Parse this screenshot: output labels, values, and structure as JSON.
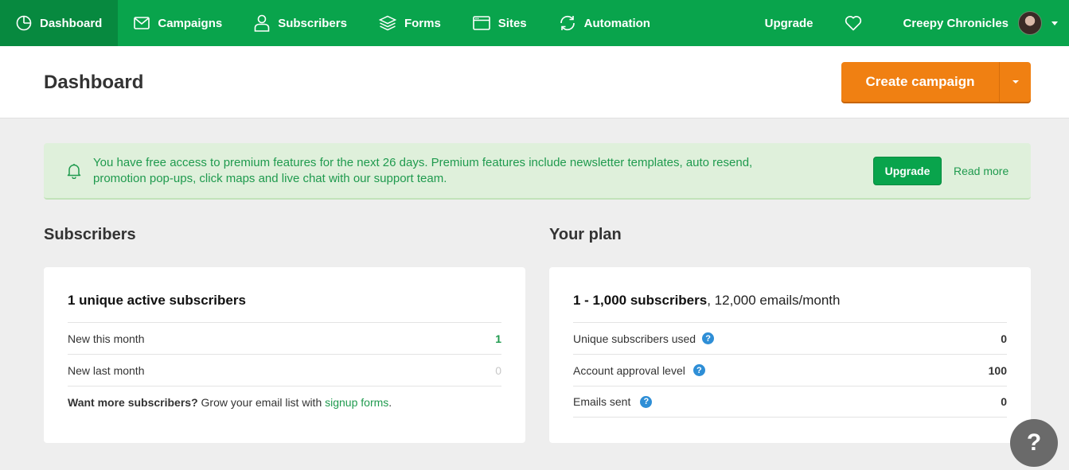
{
  "nav": {
    "items": [
      {
        "label": "Dashboard",
        "icon": "dashboard-icon"
      },
      {
        "label": "Campaigns",
        "icon": "mail-icon"
      },
      {
        "label": "Subscribers",
        "icon": "user-icon"
      },
      {
        "label": "Forms",
        "icon": "layers-icon"
      },
      {
        "label": "Sites",
        "icon": "browser-icon"
      },
      {
        "label": "Automation",
        "icon": "refresh-icon"
      }
    ],
    "upgrade_label": "Upgrade",
    "account_name": "Creepy Chronicles"
  },
  "header": {
    "title": "Dashboard",
    "create_label": "Create campaign"
  },
  "notice": {
    "text": "You have free access to premium features for the next 26 days. Premium features include newsletter templates, auto resend, promotion pop-ups, click maps and live chat with our support team.",
    "upgrade_label": "Upgrade",
    "read_more_label": "Read more"
  },
  "subscribers": {
    "section_title": "Subscribers",
    "headline": "1 unique active subscribers",
    "rows": [
      {
        "label": "New this month",
        "value": "1"
      },
      {
        "label": "New last month",
        "value": "0"
      }
    ],
    "cta_bold": "Want more subscribers?",
    "cta_text": " Grow your email list with ",
    "cta_link": "signup forms",
    "cta_end": "."
  },
  "plan": {
    "section_title": "Your plan",
    "headline_bold": "1 - 1,000 subscribers",
    "headline_rest": ", 12,000 emails/month",
    "rows": [
      {
        "label": "Unique subscribers used",
        "value": "0"
      },
      {
        "label": "Account approval level",
        "value": "100"
      },
      {
        "label": "Emails sent",
        "value": "0"
      }
    ]
  },
  "help_fab": "?",
  "colors": {
    "brand": "#09a44c",
    "accent": "#f08012",
    "notice_bg": "#dff0db",
    "info": "#2e8ed6"
  }
}
